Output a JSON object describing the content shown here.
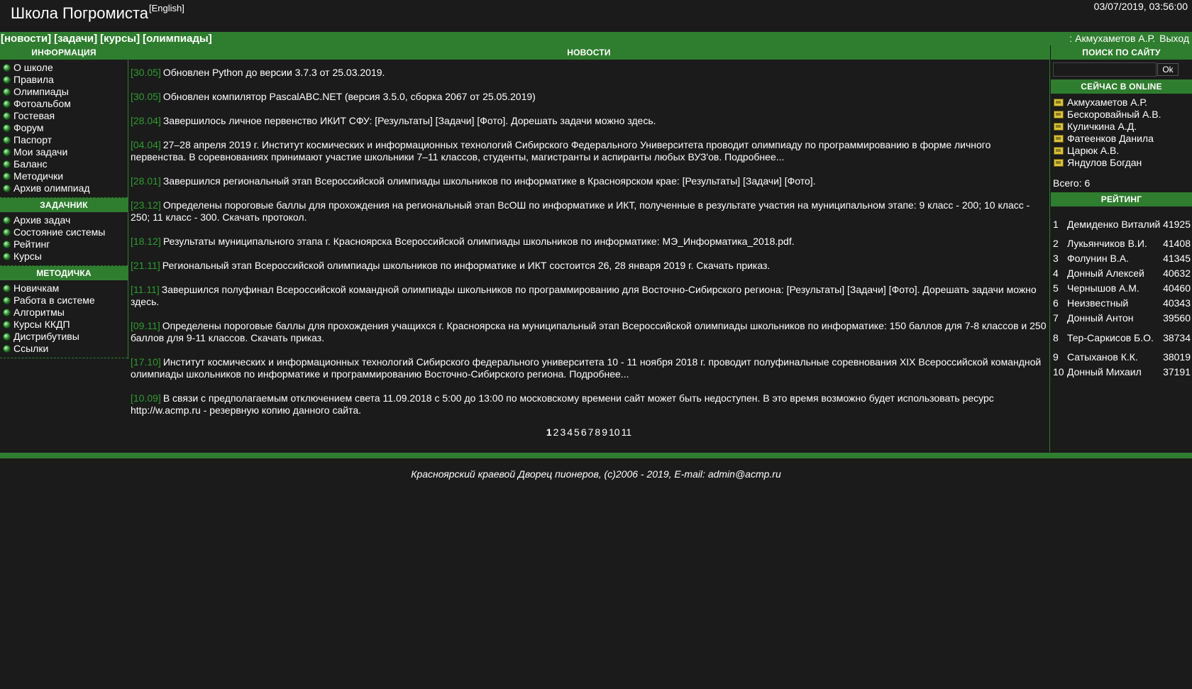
{
  "header": {
    "site_title": "Школа Погромиста",
    "lang_link": "[English]",
    "datetime": "03/07/2019, 03:56:00"
  },
  "nav": {
    "links": [
      "[новости]",
      "[задачи]",
      "[курсы]",
      "[олимпиады]"
    ],
    "user_prefix": ":",
    "user_name": "Акмухаметов А.Р.",
    "logout": "Выход"
  },
  "colors": {
    "accent": "#2f7d2f",
    "date_green": "#2f9a2f",
    "background": "#1b1b1b"
  },
  "left": {
    "info_title": "ИНФОРМАЦИЯ",
    "info_items": [
      "О школе",
      "Правила",
      "Олимпиады",
      "Фотоальбом",
      "Гостевая",
      "Форум",
      "Паспорт",
      "Мои задачи",
      "Баланс",
      "Методички",
      "Архив олимпиад"
    ],
    "tasks_title": "ЗАДАЧНИК",
    "tasks_items": [
      "Архив задач",
      "Состояние системы",
      "Рейтинг",
      "Курсы"
    ],
    "method_title": "МЕТОДИЧКА",
    "method_items": [
      "Новичкам",
      "Работа в системе",
      "Алгоритмы",
      "Курсы ККДП",
      "Дистрибутивы",
      "Ссылки"
    ],
    "bullet_icon": "green-ball-icon"
  },
  "news": {
    "title": "НОВОСТИ",
    "items": [
      {
        "date": "[30.05]",
        "text": "Обновлен Python до версии 3.7.3 от 25.03.2019."
      },
      {
        "date": "[30.05]",
        "text": "Обновлен компилятор PascalABC.NET (версия 3.5.0, сборка 2067 от 25.05.2019)"
      },
      {
        "date": "[28.04]",
        "text": "Завершилось личное первенство ИКИТ СФУ: [Результаты] [Задачи] [Фото]. Дорешать задачи можно здесь."
      },
      {
        "date": "[04.04]",
        "text": "27–28 апреля 2019 г. Институт космических и информационных технологий Сибирского Федерального Университета проводит олимпиаду по программированию в форме личного первенства. В соревнованиях принимают участие школьники 7–11 классов, студенты, магистранты и аспиранты любых ВУЗ'ов. Подробнее..."
      },
      {
        "date": "[28.01]",
        "text": "Завершился региональный этап Всероссийской олимпиады школьников по информатике в Красноярском крае: [Результаты] [Задачи] [Фото]."
      },
      {
        "date": "[23.12]",
        "text": "Определены пороговые баллы для прохождения на региональный этап ВсОШ по информатике и ИКТ, полученные в результате участия на муниципальном этапе: 9 класс - 200; 10 класс - 250; 11 класс - 300. Скачать протокол."
      },
      {
        "date": "[18.12]",
        "text": "Результаты муниципального этапа г. Красноярска Всероссийской олимпиады школьников по информатике: МЭ_Информатика_2018.pdf."
      },
      {
        "date": "[21.11]",
        "text": "Региональный этап Всероссийской олимпиады школьников по информатике и ИКТ состоится 26, 28 января 2019 г. Скачать приказ."
      },
      {
        "date": "[11.11]",
        "text": "Завершился полуфинал Всероссийской командной олимпиады школьников по программированию для Восточно-Сибирского региона: [Результаты] [Задачи] [Фото]. Дорешать задачи можно здесь."
      },
      {
        "date": "[09.11]",
        "text": "Определены пороговые баллы для прохождения учащихся г. Красноярска на муниципальный этап Всероссийской олимпиады школьников по информатике: 150 баллов для 7-8 классов и 250 баллов для 9-11 классов. Скачать приказ."
      },
      {
        "date": "[17.10]",
        "text": "Институт космических и информационных технологий Сибирского федерального университета 10 - 11 ноября 2018 г. проводит полуфинальные соревнования XIX Всероссийской командной олимпиады школьников по информатике и программированию Восточно-Сибирского региона. Подробнее..."
      },
      {
        "date": "[10.09]",
        "text": "В связи с предполагаемым отключением света 11.09.2018 с 5:00 до 13:00 по московскому времени сайт может быть недоступен. В это время возможно будет использовать ресурс http://w.acmp.ru - резервную копию данного сайта."
      }
    ],
    "pages": [
      "1",
      "2",
      "3",
      "4",
      "5",
      "6",
      "7",
      "8",
      "9",
      "10",
      "11"
    ],
    "current_page": "1"
  },
  "right": {
    "search_title": "ПОИСК ПО САЙТУ",
    "search_value": "",
    "search_button": "Ok",
    "online_title": "СЕЙЧАС В ONLINE",
    "online_users": [
      "Акмухаметов А.Р.",
      "Бескоровайный А.В.",
      "Куличкина А.Д.",
      "Фатеенков Данила",
      "Царюк А.В.",
      "Яндулов Богдан"
    ],
    "online_total": "Всего: 6",
    "rating_title": "РЕЙТИНГ",
    "rating": [
      {
        "n": "1",
        "name": "Демиденко Виталий",
        "score": "41925"
      },
      {
        "n": "2",
        "name": "Лукьянчиков В.И.",
        "score": "41408"
      },
      {
        "n": "3",
        "name": "Фолунин В.А.",
        "score": "41345"
      },
      {
        "n": "4",
        "name": "Донный Алексей",
        "score": "40632"
      },
      {
        "n": "5",
        "name": "Чернышов А.М.",
        "score": "40460"
      },
      {
        "n": "6",
        "name": "Неизвестный",
        "score": "40343"
      },
      {
        "n": "7",
        "name": "Донный Антон",
        "score": "39560"
      },
      {
        "n": "8",
        "name": "Тер-Саркисов Б.О.",
        "score": "38734"
      },
      {
        "n": "9",
        "name": "Сатыханов К.К.",
        "score": "38019"
      },
      {
        "n": "10",
        "name": "Донный Михаил",
        "score": "37191"
      }
    ]
  },
  "footer": {
    "text": "Красноярский краевой Дворец пионеров, (c)2006 - 2019, E-mail: admin@acmp.ru"
  }
}
